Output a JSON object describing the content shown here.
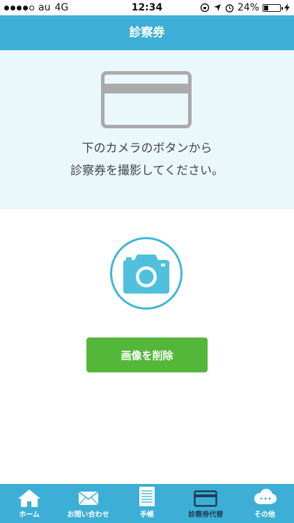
{
  "status_bar": {
    "carrier": "au",
    "network": "4G",
    "time": "12:34",
    "battery": "24%",
    "battery_level": 0.24
  },
  "header": {
    "title": "診察券"
  },
  "info": {
    "line1": "下のカメラのボタンから",
    "line2": "診察券を撮影してください。"
  },
  "delete_button": {
    "label": "画像を削除"
  },
  "tabs": [
    {
      "label": "ホーム",
      "icon": "home-icon"
    },
    {
      "label": "お問い合わせ",
      "icon": "mail-icon"
    },
    {
      "label": "手帳",
      "icon": "notebook-icon"
    },
    {
      "label": "診察券代替",
      "icon": "card-icon",
      "active": true
    },
    {
      "label": "その他",
      "icon": "cloud-icon"
    }
  ],
  "colors": {
    "header": "#3dafd6",
    "info_bg": "#eaf7fb",
    "camera": "#4fc0dd",
    "delete": "#53b83a",
    "active_tab": "#1d3f57"
  }
}
